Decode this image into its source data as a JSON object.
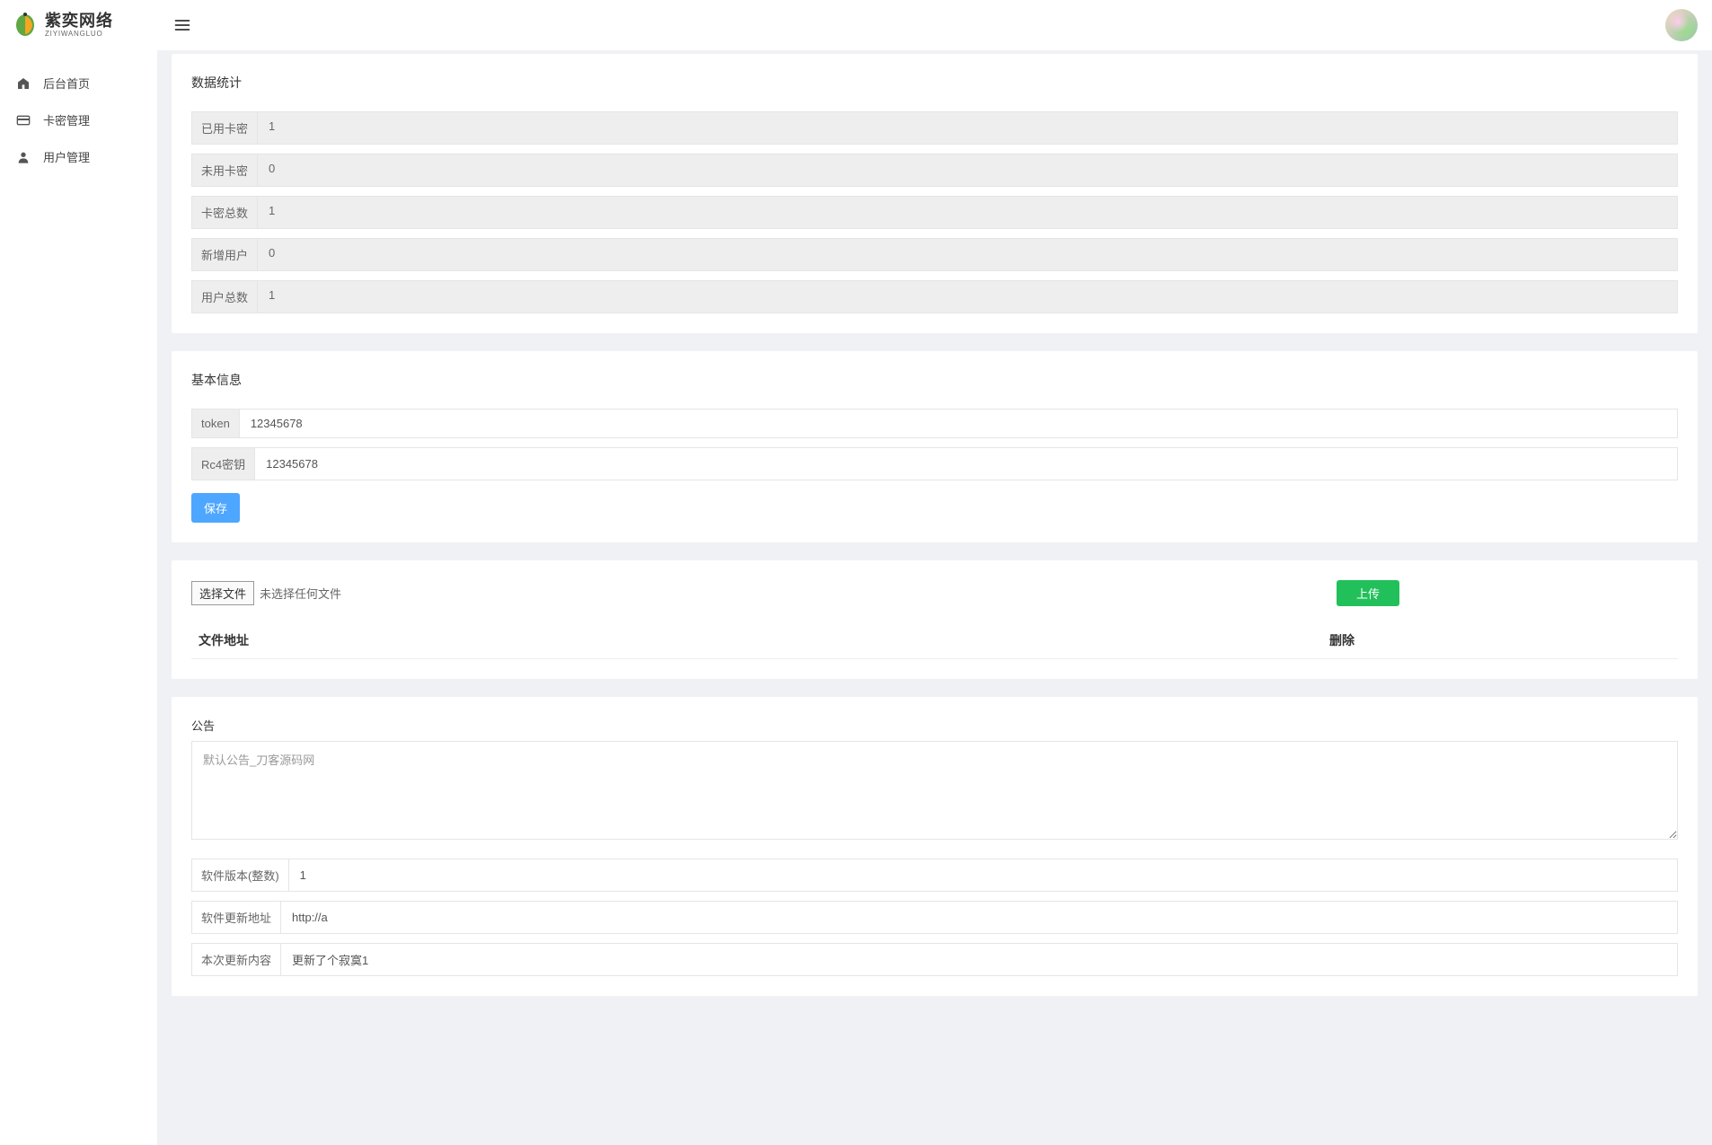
{
  "logo": {
    "cn": "紫奕网络",
    "en": "ZIYIWANGLUO"
  },
  "sidebar": {
    "items": [
      {
        "label": "后台首页",
        "icon": "home"
      },
      {
        "label": "卡密管理",
        "icon": "card"
      },
      {
        "label": "用户管理",
        "icon": "user"
      }
    ]
  },
  "stats": {
    "title": "数据统计",
    "rows": [
      {
        "label": "已用卡密",
        "value": "1"
      },
      {
        "label": "未用卡密",
        "value": "0"
      },
      {
        "label": "卡密总数",
        "value": "1"
      },
      {
        "label": "新增用户",
        "value": "0"
      },
      {
        "label": "用户总数",
        "value": "1"
      }
    ]
  },
  "basic": {
    "title": "基本信息",
    "token_label": "token",
    "token_value": "12345678",
    "rc4_label": "Rc4密钥",
    "rc4_value": "12345678",
    "save_label": "保存"
  },
  "upload": {
    "choose_label": "选择文件",
    "no_file": "未选择任何文件",
    "upload_label": "上传",
    "col_address": "文件地址",
    "col_delete": "删除"
  },
  "notice": {
    "label": "公告",
    "value": "默认公告_刀客源码网",
    "version_label": "软件版本(整数)",
    "version_value": "1",
    "url_label": "软件更新地址",
    "url_value": "http://a",
    "content_label": "本次更新内容",
    "content_value": "更新了个寂寞1"
  }
}
